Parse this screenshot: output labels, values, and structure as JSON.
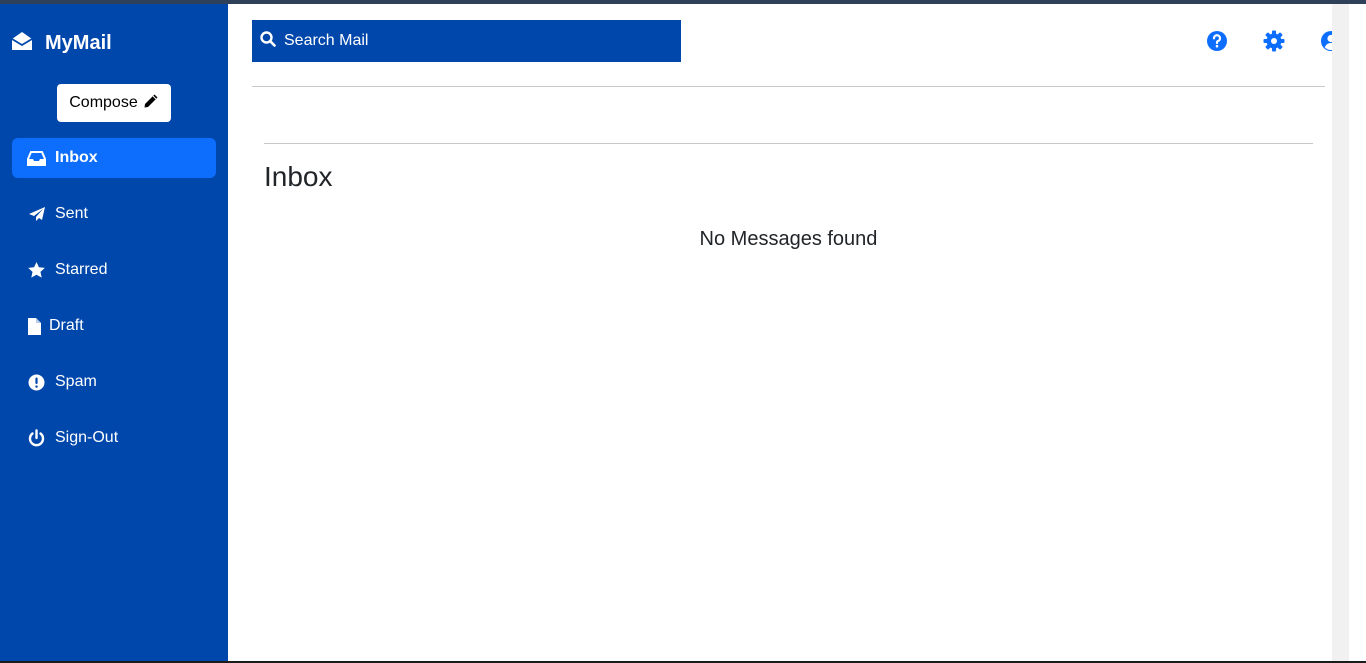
{
  "app": {
    "brand": "MyMail"
  },
  "sidebar": {
    "compose_label": "Compose",
    "items": [
      {
        "label": "Inbox",
        "icon": "inbox-icon",
        "active": true
      },
      {
        "label": "Sent",
        "icon": "paper-plane-icon",
        "active": false
      },
      {
        "label": "Starred",
        "icon": "star-icon",
        "active": false
      },
      {
        "label": "Draft",
        "icon": "file-icon",
        "active": false
      },
      {
        "label": "Spam",
        "icon": "exclamation-circle-icon",
        "active": false
      },
      {
        "label": "Sign-Out",
        "icon": "power-icon",
        "active": false
      }
    ]
  },
  "header": {
    "search_placeholder": "Search Mail",
    "icons": [
      "help-icon",
      "settings-icon",
      "user-icon"
    ]
  },
  "main": {
    "title": "Inbox",
    "empty_message": "No Messages found"
  },
  "colors": {
    "sidebar_bg": "#0047ab",
    "active_item": "#0d6efd",
    "icon_accent": "#0d6efd"
  }
}
